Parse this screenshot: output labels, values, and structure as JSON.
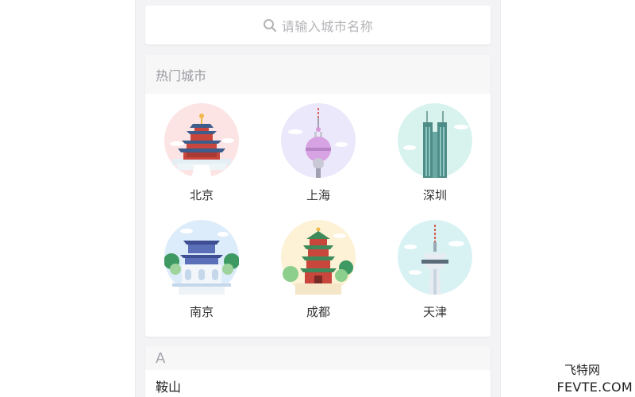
{
  "search": {
    "placeholder": "请输入城市名称",
    "icon": "search-icon"
  },
  "hot_cities": {
    "title": "热门城市",
    "items": [
      {
        "name": "北京",
        "icon": "temple-of-heaven-icon",
        "bg": "#fde4e4"
      },
      {
        "name": "上海",
        "icon": "oriental-pearl-tower-icon",
        "bg": "#ece8fb"
      },
      {
        "name": "深圳",
        "icon": "skyscraper-icon",
        "bg": "#d8f3ee"
      },
      {
        "name": "南京",
        "icon": "city-gate-icon",
        "bg": "#ddecfa"
      },
      {
        "name": "成都",
        "icon": "pagoda-tower-icon",
        "bg": "#fdf1d6"
      },
      {
        "name": "天津",
        "icon": "tv-tower-icon",
        "bg": "#d8f2f4"
      }
    ]
  },
  "index": {
    "letter": "A",
    "items": [
      "鞍山"
    ]
  },
  "watermark": {
    "line1": "飞特网",
    "line2": "FEVTE.COM"
  },
  "colors": {
    "background": "#f3f3f5",
    "card": "#ffffff",
    "section_header": "#f7f7f8",
    "muted_text": "#9a9aa0"
  }
}
